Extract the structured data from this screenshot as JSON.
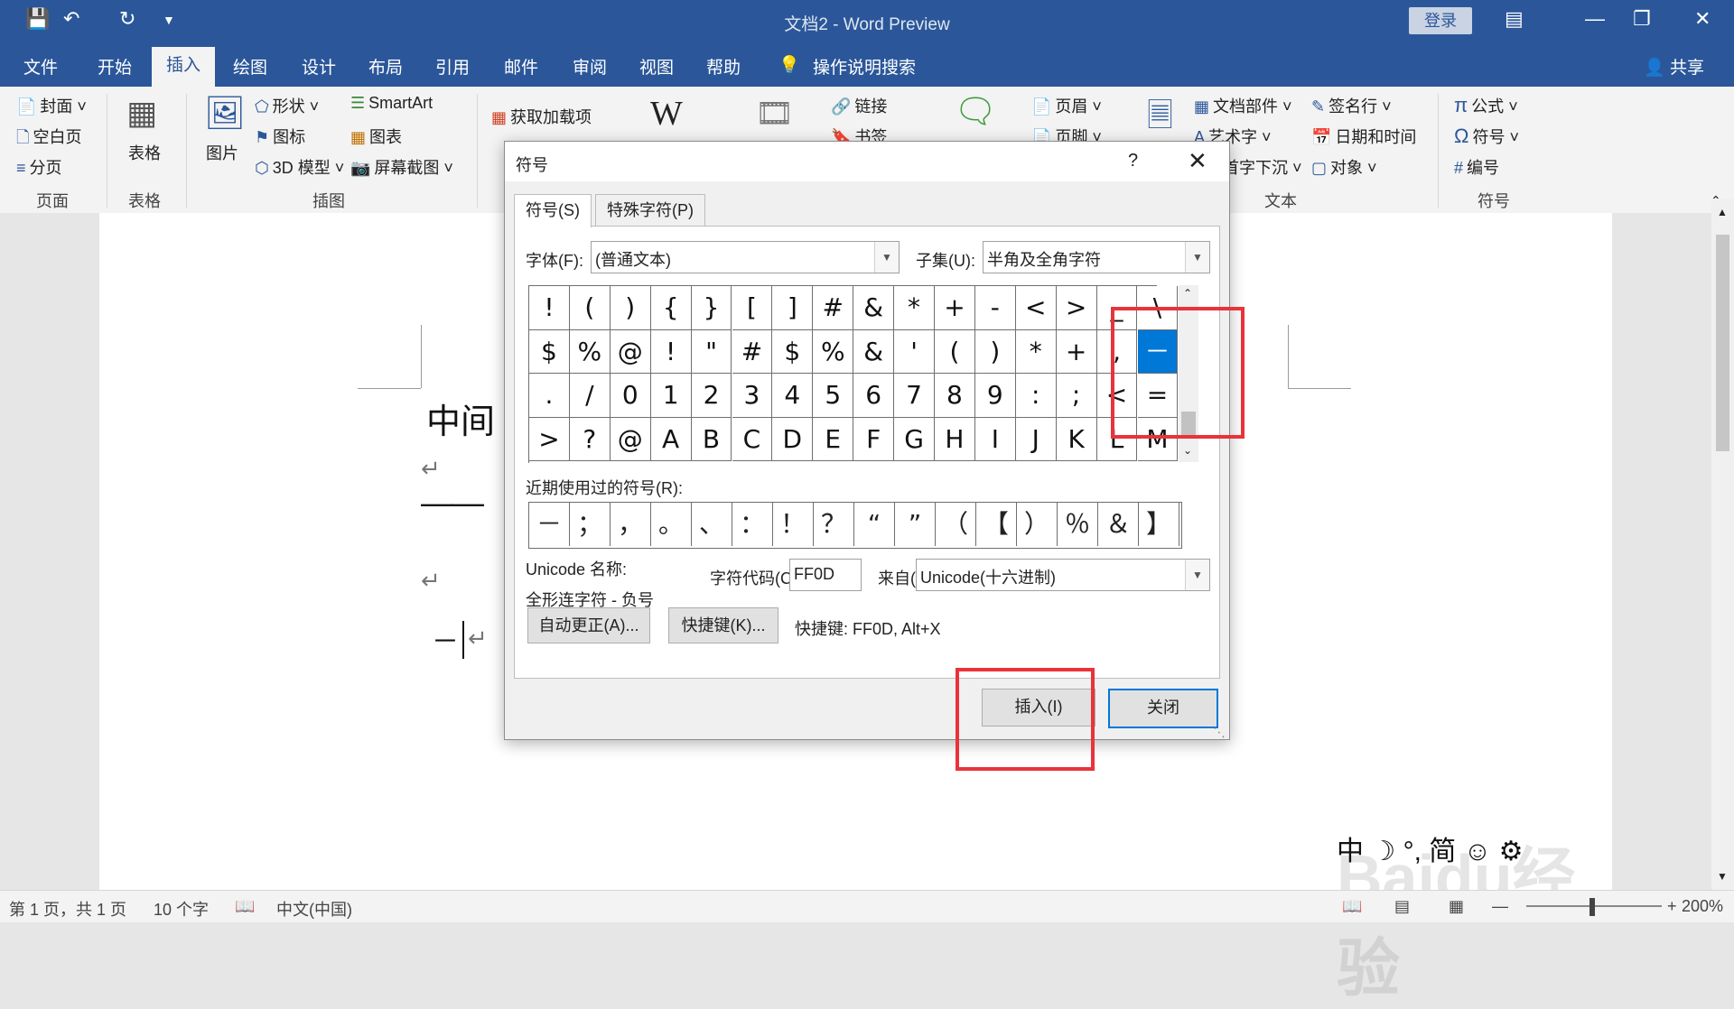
{
  "titlebar": {
    "doc_title": "文档2 - Word Preview",
    "login": "登录"
  },
  "tabs": [
    "文件",
    "开始",
    "插入",
    "绘图",
    "设计",
    "布局",
    "引用",
    "邮件",
    "审阅",
    "视图",
    "帮助"
  ],
  "tell_me": "操作说明搜索",
  "share": "共享",
  "ribbon": {
    "pages": {
      "cover": "封面",
      "blank": "空白页",
      "break": "分页",
      "group": "页面"
    },
    "tables": {
      "table": "表格",
      "group": "表格"
    },
    "illustrations": {
      "pictures": "图片",
      "shapes": "形状",
      "icons": "图标",
      "model3d": "3D 模型",
      "smartart": "SmartArt",
      "chart": "图表",
      "screenshot": "屏幕截图",
      "group": "插图"
    },
    "addins": {
      "get": "获取加载项"
    },
    "links": {
      "link": "链接",
      "bookmark": "书签"
    },
    "header_footer": {
      "header": "页眉",
      "footer": "页脚"
    },
    "text": {
      "quickparts": "文档部件",
      "wordart": "艺术字",
      "dropcap": "首字下沉",
      "signature": "签名行",
      "datetime": "日期和时间",
      "object": "对象",
      "group": "文本"
    },
    "symbols": {
      "equation": "公式",
      "symbol": "符号",
      "number": "编号",
      "group": "符号"
    }
  },
  "document": {
    "line1": "中间",
    "dash_line": "——",
    "last_line": "－"
  },
  "dialog": {
    "title": "符号",
    "help": "?",
    "tab_symbol": "符号(S)",
    "tab_special": "特殊字符(P)",
    "font_label": "字体(F):",
    "font_value": "(普通文本)",
    "subset_label": "子集(U):",
    "subset_value": "半角及全角字符",
    "grid": [
      [
        "!",
        "(",
        ")",
        "{",
        "}",
        "[",
        "]",
        "#",
        "&",
        "*",
        "+",
        "-",
        "<",
        ">",
        "_",
        "\\"
      ],
      [
        "$",
        "%",
        "@",
        "!",
        "\"",
        "#",
        "$",
        "%",
        "&",
        "'",
        "(",
        ")",
        "*",
        "+",
        ",",
        "－"
      ],
      [
        ".",
        "/",
        "0",
        "1",
        "2",
        "3",
        "4",
        "5",
        "6",
        "7",
        "8",
        "9",
        ":",
        ";",
        "<",
        "="
      ],
      [
        ">",
        "?",
        "@",
        "A",
        "B",
        "C",
        "D",
        "E",
        "F",
        "G",
        "H",
        "I",
        "J",
        "K",
        "L",
        "M"
      ]
    ],
    "recent_label": "近期使用过的符号(R):",
    "recent": [
      "－",
      "；",
      "，",
      "。",
      "、",
      "：",
      "！",
      "？",
      "“",
      "”",
      "（",
      "【",
      "）",
      "％",
      "＆",
      "】"
    ],
    "unicode_name_label": "Unicode 名称:",
    "unicode_name": "全形连字符 - 负号",
    "char_code_label": "字符代码(C):",
    "char_code": "FF0D",
    "from_label": "来自(M):",
    "from_value": "Unicode(十六进制)",
    "autocorrect": "自动更正(A)...",
    "shortcut_key": "快捷键(K)...",
    "shortcut_text": "快捷键: FF0D, Alt+X",
    "insert": "插入(I)",
    "close": "关闭"
  },
  "status": {
    "page": "第 1 页，共 1 页",
    "words": "10 个字",
    "lang": "中文(中国)",
    "zoom": "200%"
  },
  "ime": [
    "中",
    "☽",
    "°,",
    "简",
    "☺",
    "⚙"
  ],
  "colors": {
    "brand": "#2b579a",
    "highlight": "#e8333b",
    "selected": "#0078d7"
  }
}
